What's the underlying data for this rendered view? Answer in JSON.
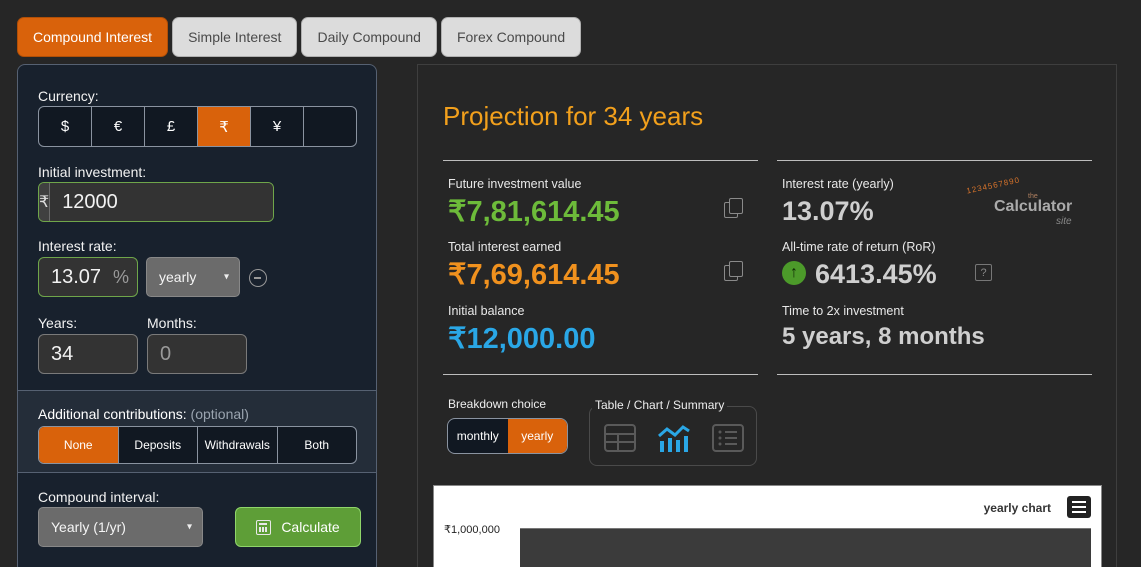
{
  "tabs": [
    "Compound Interest",
    "Simple Interest",
    "Daily Compound",
    "Forex Compound"
  ],
  "left": {
    "currency_label": "Currency:",
    "currencies": [
      "$",
      "€",
      "£",
      "₹",
      "¥",
      ""
    ],
    "initial_label": "Initial investment:",
    "initial_prefix": "₹",
    "initial_value": "12000",
    "rate_label": "Interest rate:",
    "rate_value": "13.07",
    "rate_suffix": "%",
    "rate_period": "yearly",
    "years_label": "Years:",
    "years_value": "34",
    "months_label": "Months:",
    "months_value": "0",
    "contrib_title": "Additional contributions:",
    "contrib_optional": "(optional)",
    "contrib_options": [
      "None",
      "Deposits",
      "Withdrawals",
      "Both"
    ],
    "interval_label": "Compound interval:",
    "interval_value": "Yearly (1/yr)",
    "calculate_label": "Calculate"
  },
  "right": {
    "title": "Projection for 34 years",
    "future_label": "Future investment value",
    "future_value": "₹7,81,614.45",
    "interest_label": "Total interest earned",
    "interest_value": "₹7,69,614.45",
    "initial_label": "Initial balance",
    "initial_value": "₹12,000.00",
    "rate_label": "Interest rate (yearly)",
    "rate_value": "13.07%",
    "ror_label": "All-time rate of return (RoR)",
    "ror_value": "6413.45%",
    "double_label": "Time to 2x investment",
    "double_value": "5 years, 8 months",
    "logo": {
      "digits": "1234567890",
      "the": "the",
      "main": "Calculator",
      "site": "site"
    },
    "breakdown_label": "Breakdown choice",
    "breakdown_options": [
      "monthly",
      "yearly"
    ],
    "view_label": "Table / Chart / Summary",
    "chart_title": "yearly chart",
    "chart_ytick": "₹1,000,000"
  },
  "colors": {
    "accent": "#d9620b",
    "green": "#6dbb3a",
    "orange": "#f0911e",
    "blue": "#2aa7e6",
    "title": "#f2a01c"
  }
}
